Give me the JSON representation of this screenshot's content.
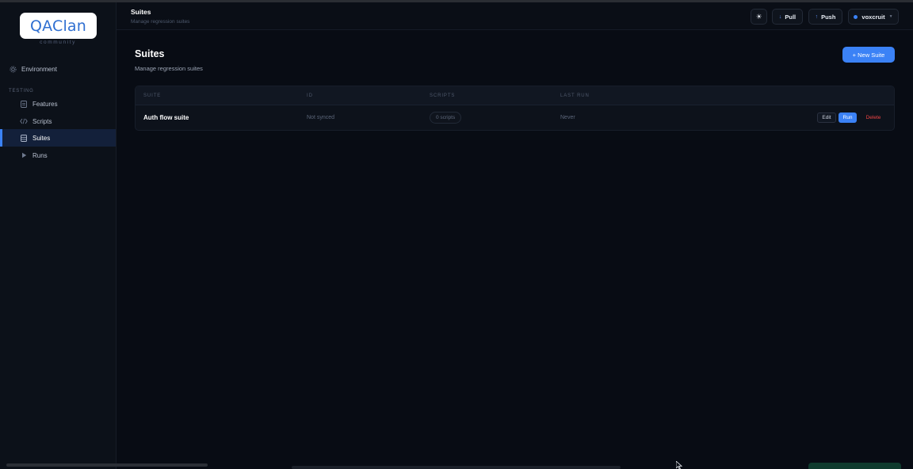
{
  "app": {
    "logo": "QAClan",
    "logo_sub": "community"
  },
  "sidebar": {
    "top_item": {
      "label": "Environment",
      "icon": "gear-icon"
    },
    "section_label": "TESTING",
    "items": [
      {
        "label": "Features",
        "icon": "document-icon",
        "active": false
      },
      {
        "label": "Scripts",
        "icon": "code-icon",
        "active": false
      },
      {
        "label": "Suites",
        "icon": "stack-icon",
        "active": true
      },
      {
        "label": "Runs",
        "icon": "play-icon",
        "active": false
      }
    ]
  },
  "header": {
    "title": "Suites",
    "subtitle": "Manage regression suites",
    "theme_icon": "sun-icon",
    "pull_label": "Pull",
    "push_label": "Push",
    "user_name": "voxcruit"
  },
  "main": {
    "title": "Suites",
    "subtitle": "Manage regression suites",
    "new_button": "+ New Suite"
  },
  "table": {
    "columns": [
      "SUITE",
      "ID",
      "SCRIPTS",
      "LAST RUN"
    ],
    "rows": [
      {
        "suite": "Auth flow suite",
        "id": "Not synced",
        "scripts": "0 scripts",
        "last_run": "Never",
        "actions": {
          "edit": "Edit",
          "run": "Run",
          "delete": "Delete"
        }
      }
    ]
  },
  "colors": {
    "accent": "#3b82f6",
    "danger": "#ef4444",
    "background": "#080c14"
  }
}
